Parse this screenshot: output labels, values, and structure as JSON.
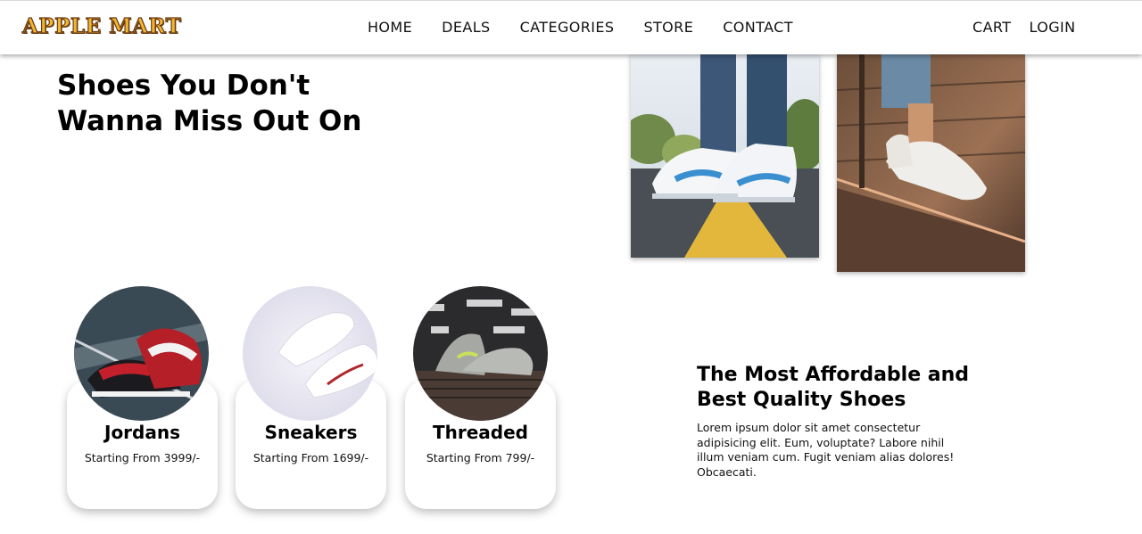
{
  "navbar": {
    "logo": "APPLE MART",
    "links": [
      "HOME",
      "DEALS",
      "CATEGORIES",
      "STORE",
      "CONTACT"
    ],
    "cart": "CART",
    "login": "LOGIN"
  },
  "hero": {
    "title": "Shoes You Don't Wanna Miss Out On"
  },
  "products": [
    {
      "name": "Jordans",
      "price": "Starting From 3999/-"
    },
    {
      "name": "Sneakers",
      "price": "Starting From 1699/-"
    },
    {
      "name": "Threaded",
      "price": "Starting From 799/-"
    }
  ],
  "tagline": {
    "title": "The Most Affordable and Best Quality Shoes",
    "text": "Lorem ipsum dolor sit amet consectetur adipisicing elit. Eum, voluptate? Labore nihil illum veniam cum. Fugit veniam alias dolores! Obcaecati."
  }
}
